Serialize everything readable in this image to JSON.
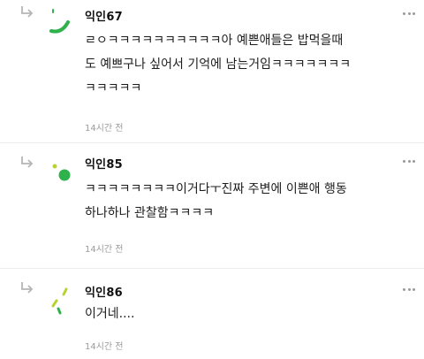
{
  "comments": [
    {
      "nickname": "익인67",
      "text": "ㄹㅇㅋㅋㅋㅋㅋㅋㅋㅋㅋㅋ아 예쁜애들은 밥먹을때\n도 예쁘구나 싶어서 기억에 남는거임ㅋㅋㅋㅋㅋㅋㅋ\nㅋㅋㅋㅋㅋ",
      "time": "14시간 전"
    },
    {
      "nickname": "익인85",
      "text": "ㅋㅋㅋㅋㅋㅋㅋㅋ이거다ㅜ진짜 주변에 이쁜애 행동\n하나하나 관찰함ㅋㅋㅋㅋ",
      "time": "14시간 전"
    },
    {
      "nickname": "익인86",
      "text": "이거네....",
      "time": "14시간 전"
    }
  ],
  "colors": {
    "avatar_green": "#2fb24c",
    "avatar_lime": "#b7d232",
    "meta_gray": "#9a9a9a"
  },
  "icons": {
    "reply": "reply-arrow-icon",
    "more": "more-options-icon"
  }
}
